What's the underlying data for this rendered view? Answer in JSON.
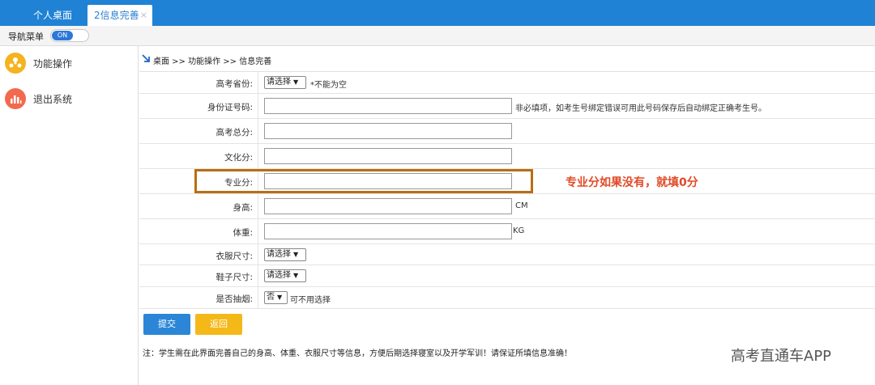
{
  "tabs": [
    {
      "label": "个人桌面"
    },
    {
      "label": "2信息完善",
      "close": "×"
    }
  ],
  "navbar": {
    "label": "导航菜单",
    "toggle": "ON"
  },
  "sidebar": {
    "items": [
      {
        "label": "功能操作",
        "icon": "gear-icon",
        "color": "#f4b31f"
      },
      {
        "label": "退出系统",
        "icon": "chart-icon",
        "color": "#f26a4e"
      }
    ]
  },
  "breadcrumb": {
    "text": "桌面 >> 功能操作 >> 信息完善"
  },
  "form": {
    "province": {
      "label": "高考省份:",
      "selected": "请选择",
      "hint": "*不能为空"
    },
    "id_number": {
      "label": "身份证号码:",
      "value": "",
      "hint": "非必填项，如考生号绑定错误可用此号码保存后自动绑定正确考生号。"
    },
    "total_score": {
      "label": "高考总分:",
      "value": ""
    },
    "culture_score": {
      "label": "文化分:",
      "value": ""
    },
    "major_score": {
      "label": "专业分:",
      "value": ""
    },
    "height": {
      "label": "身高:",
      "value": "",
      "unit": "CM"
    },
    "weight": {
      "label": "体重:",
      "value": "",
      "unit": "KG"
    },
    "clothes_size": {
      "label": "衣服尺寸:",
      "selected": "请选择"
    },
    "shoe_size": {
      "label": "鞋子尺寸:",
      "selected": "请选择"
    },
    "smoking": {
      "label": "是否抽烟:",
      "selected": "否",
      "hint": "可不用选择"
    }
  },
  "buttons": {
    "submit": "提交",
    "back": "返回"
  },
  "annotation": "专业分如果没有，就填0分",
  "note": "注：学生需在此界面完善自己的身高、体重、衣服尺寸等信息，方便后期选择寝室以及开学军训！请保证所填信息准确！",
  "watermark": "高考直通车APP"
}
